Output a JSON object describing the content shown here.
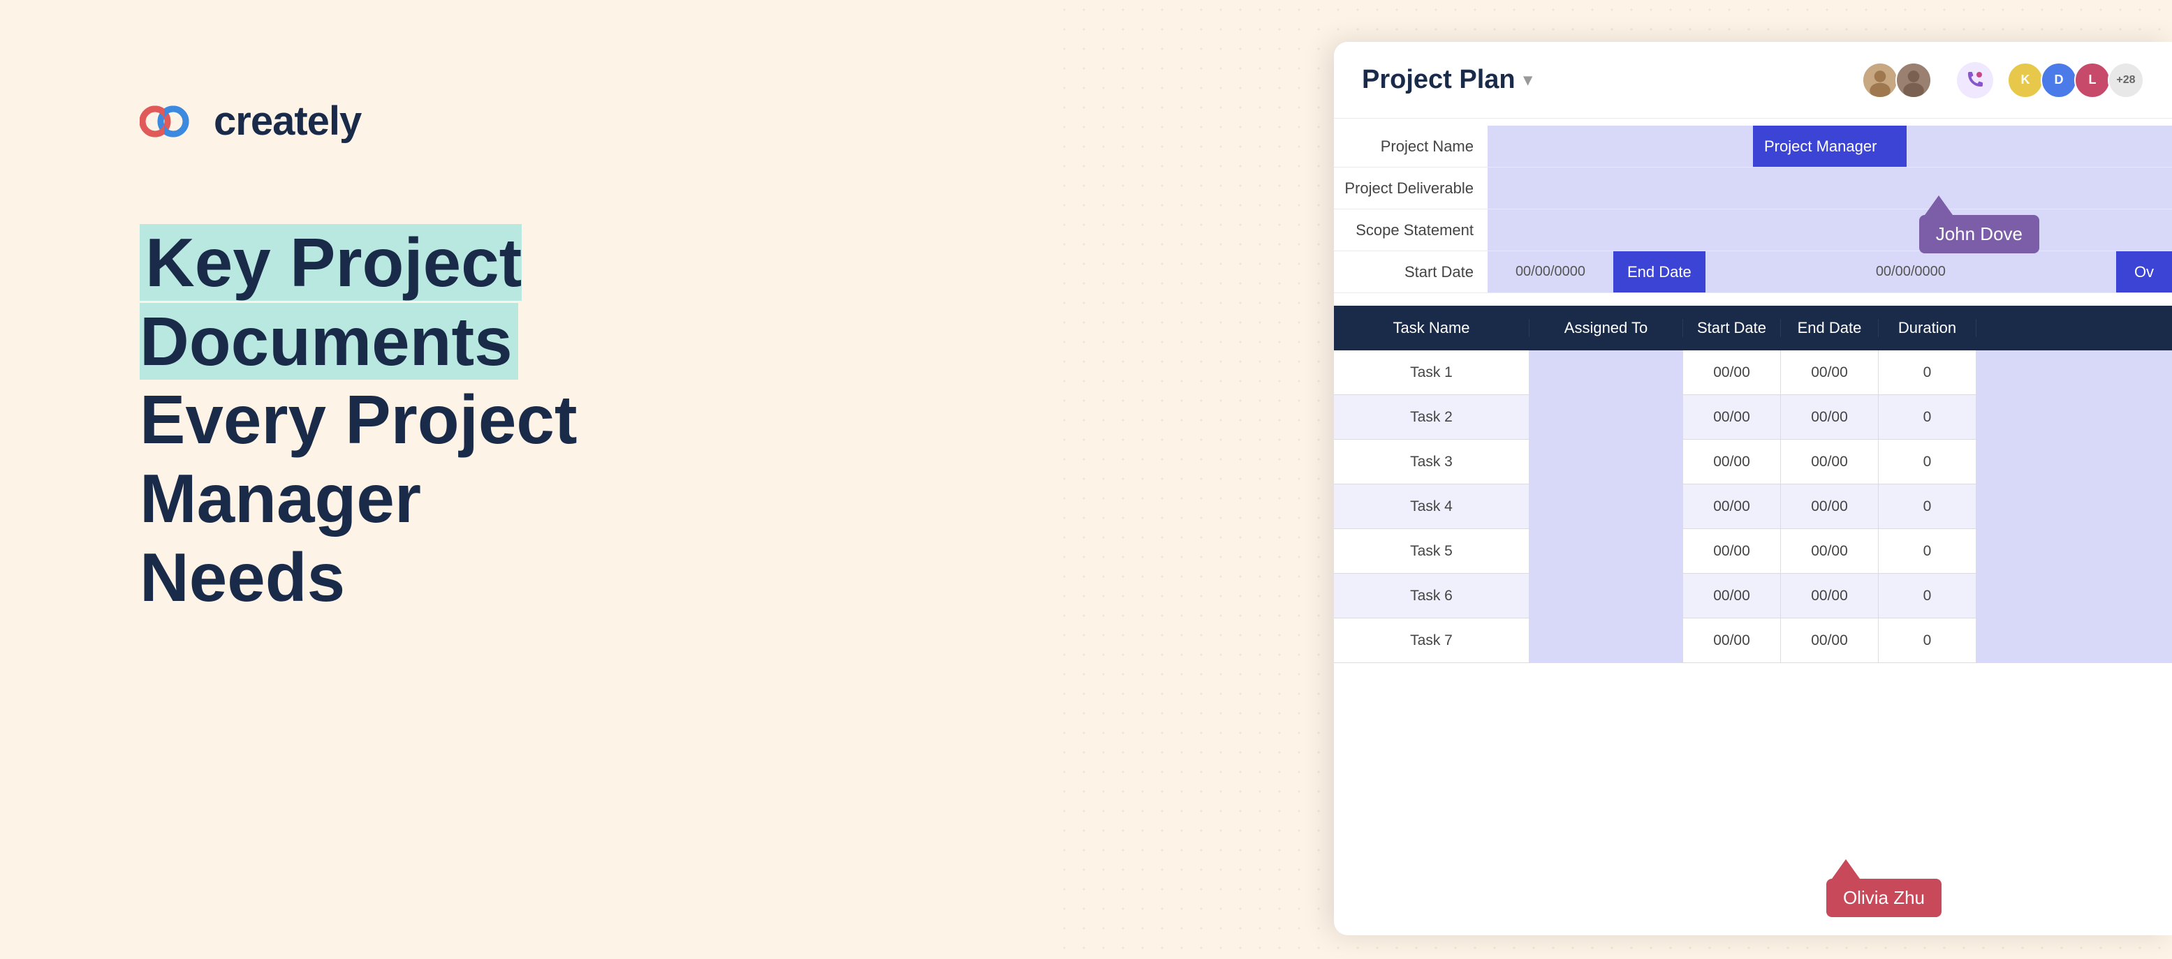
{
  "background": {
    "color": "#fdf3e7"
  },
  "logo": {
    "text": "creately",
    "icon_name": "creately-logo-icon"
  },
  "headline": {
    "line1": "Key Project Documents",
    "line2": "Every Project Manager",
    "line3": "Needs",
    "highlight_color": "#b8e8e0"
  },
  "app": {
    "title": "Project Plan",
    "dropdown_arrow": "▾",
    "avatars": [
      {
        "type": "photo",
        "color": "#c8a882",
        "label": "avatar-user1"
      },
      {
        "type": "photo",
        "color": "#a0856a",
        "label": "avatar-user2"
      }
    ],
    "phone_icon": "📞",
    "avatar_group2": [
      {
        "initials": "K",
        "color": "#e8c84a",
        "text_color": "#1a2b4a"
      },
      {
        "initials": "D",
        "color": "#3b44d4",
        "text_color": "white"
      },
      {
        "initials": "L",
        "color": "#c84a6a",
        "text_color": "white"
      }
    ],
    "avatar_extra": "+28"
  },
  "info_rows": [
    {
      "label": "Project Name",
      "value": "",
      "value_type": "purple_light",
      "side_label": "Project Manager",
      "side_color": "blue"
    },
    {
      "label": "Project Deliverable",
      "value": "",
      "value_type": "purple_light"
    },
    {
      "label": "Scope Statement",
      "value": "",
      "value_type": "purple_light"
    }
  ],
  "date_row": {
    "label": "Start Date",
    "start_value": "00/00/0000",
    "end_label": "End Date",
    "end_value": "00/00/0000",
    "over_label": "Ov"
  },
  "table": {
    "headers": [
      {
        "key": "task_name",
        "label": "Task Name"
      },
      {
        "key": "assigned_to",
        "label": "Assigned To"
      },
      {
        "key": "start_date",
        "label": "Start Date"
      },
      {
        "key": "end_date",
        "label": "End Date"
      },
      {
        "key": "duration",
        "label": "Duration"
      }
    ],
    "rows": [
      {
        "task": "Task 1",
        "assigned": "",
        "start": "00/00",
        "end": "00/00",
        "duration": "0"
      },
      {
        "task": "Task 2",
        "assigned": "",
        "start": "00/00",
        "end": "00/00",
        "duration": "0"
      },
      {
        "task": "Task 3",
        "assigned": "",
        "start": "00/00",
        "end": "00/00",
        "duration": "0"
      },
      {
        "task": "Task 4",
        "assigned": "",
        "start": "00/00",
        "end": "00/00",
        "duration": "0"
      },
      {
        "task": "Task 5",
        "assigned": "",
        "start": "00/00",
        "end": "00/00",
        "duration": "0"
      },
      {
        "task": "Task 6",
        "assigned": "",
        "start": "00/00",
        "end": "00/00",
        "duration": "0"
      },
      {
        "task": "Task 7",
        "assigned": "",
        "start": "00/00",
        "end": "00/00",
        "duration": "0"
      }
    ]
  },
  "cursors": {
    "john": {
      "name": "John Dove",
      "color": "#7b5ea7"
    },
    "olivia": {
      "name": "Olivia Zhu",
      "color": "#c84a5a"
    }
  }
}
